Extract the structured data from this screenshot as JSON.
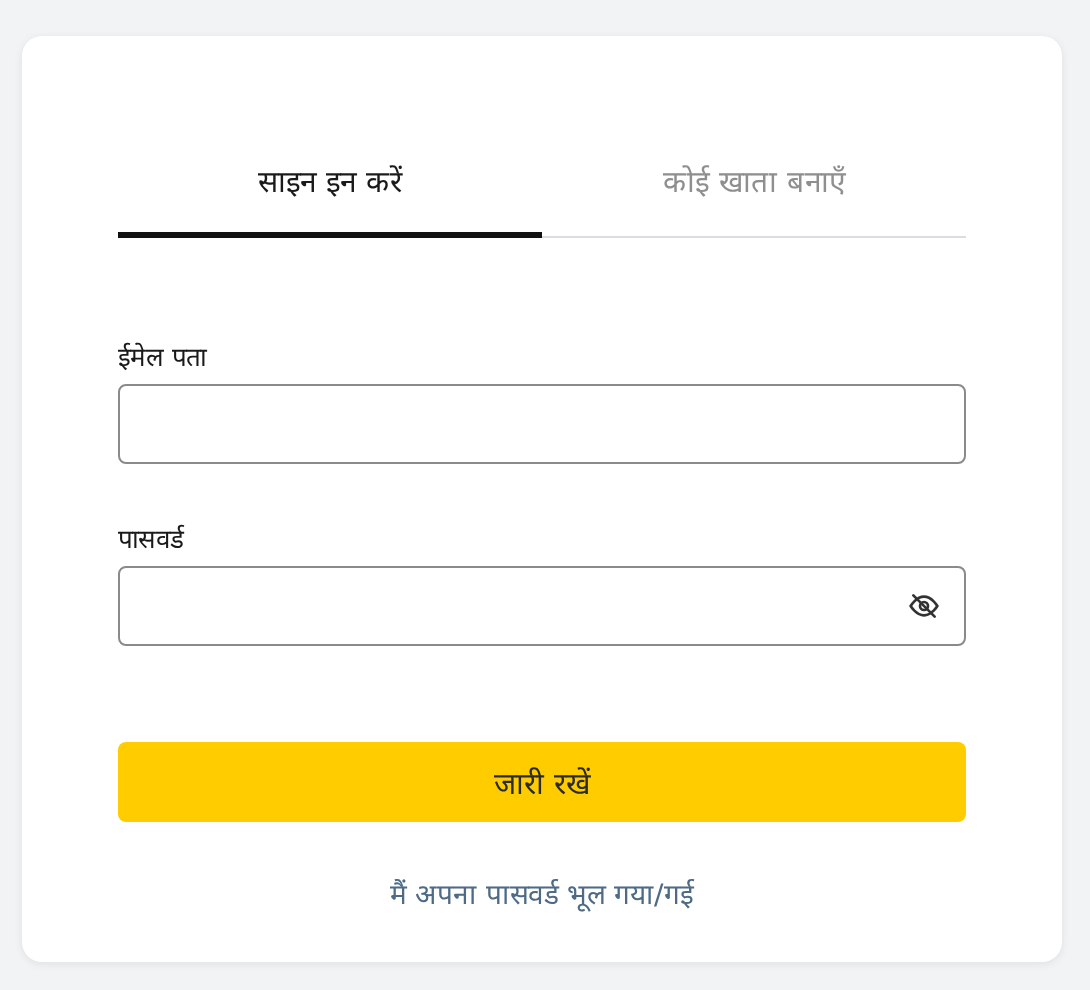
{
  "tabs": [
    {
      "label": "साइन इन करें",
      "selected": true
    },
    {
      "label": "कोई खाता बनाएँ",
      "selected": false
    }
  ],
  "fields": [
    {
      "label": "ईमेल पता",
      "kind": "text"
    },
    {
      "label": "पासवर्ड",
      "kind": "password"
    }
  ],
  "submit_button": "जारी रखें",
  "forgot_link": "मैं अपना पासवर्ड भूल गया/गई"
}
